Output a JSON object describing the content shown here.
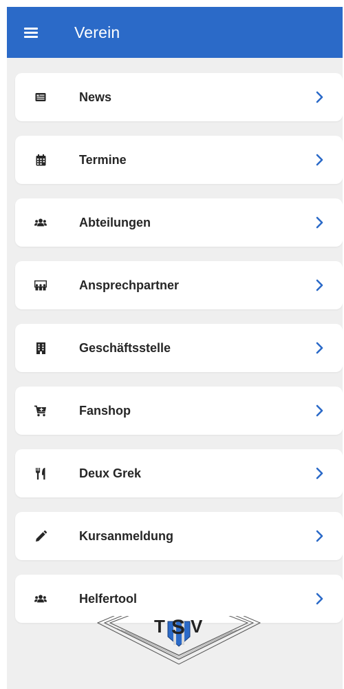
{
  "appbar": {
    "title": "Verein",
    "menu_icon": "hamburger-menu-icon",
    "color": "#2b6ac8"
  },
  "accent_color": "#2b6ac8",
  "menu": {
    "items": [
      {
        "label": "News",
        "icon": "newspaper-icon"
      },
      {
        "label": "Termine",
        "icon": "calendar-icon"
      },
      {
        "label": "Abteilungen",
        "icon": "users-icon"
      },
      {
        "label": "Ansprechpartner",
        "icon": "chalkboard-teacher-icon"
      },
      {
        "label": "Geschäftsstelle",
        "icon": "building-icon"
      },
      {
        "label": "Fanshop",
        "icon": "shopping-cart-icon"
      },
      {
        "label": "Deux Grek",
        "icon": "utensils-icon"
      },
      {
        "label": "Kursanmeldung",
        "icon": "pencil-icon"
      },
      {
        "label": "Helfertool",
        "icon": "users-icon"
      }
    ]
  },
  "logo": {
    "text_t": "T",
    "text_s": "S",
    "text_v": "V"
  }
}
